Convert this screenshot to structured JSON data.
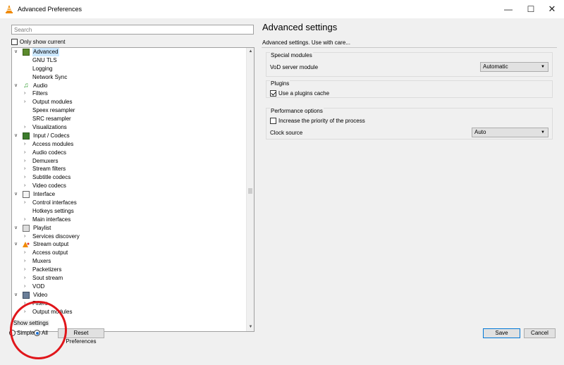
{
  "window": {
    "title": "Advanced Preferences",
    "minimize_glyph": "—",
    "maximize_glyph": "☐",
    "close_glyph": "✕"
  },
  "search": {
    "placeholder": "Search",
    "value": ""
  },
  "only_current": {
    "label": "Only show current",
    "checked": false
  },
  "tree": {
    "items": [
      {
        "label": "Advanced",
        "level": 0,
        "expanded": true,
        "icon": "advanced-icon",
        "selected": true
      },
      {
        "label": "GNU TLS",
        "level": 1,
        "has_children": false
      },
      {
        "label": "Logging",
        "level": 1,
        "has_children": false
      },
      {
        "label": "Network Sync",
        "level": 1,
        "has_children": false
      },
      {
        "label": "Audio",
        "level": 0,
        "expanded": true,
        "icon": "audio-icon"
      },
      {
        "label": "Filters",
        "level": 1,
        "has_children": true
      },
      {
        "label": "Output modules",
        "level": 1,
        "has_children": true
      },
      {
        "label": "Speex resampler",
        "level": 1,
        "has_children": false
      },
      {
        "label": "SRC resampler",
        "level": 1,
        "has_children": false
      },
      {
        "label": "Visualizations",
        "level": 1,
        "has_children": true
      },
      {
        "label": "Input / Codecs",
        "level": 0,
        "expanded": true,
        "icon": "input-codecs-icon"
      },
      {
        "label": "Access modules",
        "level": 1,
        "has_children": true
      },
      {
        "label": "Audio codecs",
        "level": 1,
        "has_children": true
      },
      {
        "label": "Demuxers",
        "level": 1,
        "has_children": true
      },
      {
        "label": "Stream filters",
        "level": 1,
        "has_children": true
      },
      {
        "label": "Subtitle codecs",
        "level": 1,
        "has_children": true
      },
      {
        "label": "Video codecs",
        "level": 1,
        "has_children": true
      },
      {
        "label": "Interface",
        "level": 0,
        "expanded": true,
        "icon": "interface-icon"
      },
      {
        "label": "Control interfaces",
        "level": 1,
        "has_children": true
      },
      {
        "label": "Hotkeys settings",
        "level": 1,
        "has_children": false
      },
      {
        "label": "Main interfaces",
        "level": 1,
        "has_children": true
      },
      {
        "label": "Playlist",
        "level": 0,
        "expanded": true,
        "icon": "playlist-icon"
      },
      {
        "label": "Services discovery",
        "level": 1,
        "has_children": true
      },
      {
        "label": "Stream output",
        "level": 0,
        "expanded": true,
        "icon": "stream-output-icon"
      },
      {
        "label": "Access output",
        "level": 1,
        "has_children": true
      },
      {
        "label": "Muxers",
        "level": 1,
        "has_children": true
      },
      {
        "label": "Packetizers",
        "level": 1,
        "has_children": true
      },
      {
        "label": "Sout stream",
        "level": 1,
        "has_children": true
      },
      {
        "label": "VOD",
        "level": 1,
        "has_children": true
      },
      {
        "label": "Video",
        "level": 0,
        "expanded": true,
        "icon": "video-icon"
      },
      {
        "label": "Filters",
        "level": 1,
        "has_children": true
      },
      {
        "label": "Output modules",
        "level": 1,
        "has_children": true
      }
    ]
  },
  "show_settings": {
    "label": "Show settings",
    "simple_label": "Simple",
    "all_label": "All",
    "selected": "all"
  },
  "buttons": {
    "reset": "Reset Preferences",
    "save": "Save",
    "cancel": "Cancel"
  },
  "right_pane": {
    "title": "Advanced settings",
    "subtitle": "Advanced settings. Use with care...",
    "special_modules": {
      "legend": "Special modules",
      "vod_label": "VoD server module",
      "vod_value": "Automatic"
    },
    "plugins": {
      "legend": "Plugins",
      "use_cache_label": "Use a plugins cache",
      "use_cache_checked": true
    },
    "performance": {
      "legend": "Performance options",
      "priority_label": "Increase the priority of the process",
      "priority_checked": false,
      "clock_label": "Clock source",
      "clock_value": "Auto"
    }
  },
  "colors": {
    "selection": "#cce8ff",
    "annotation_circle": "#e0161b",
    "accent": "#0078d7"
  }
}
